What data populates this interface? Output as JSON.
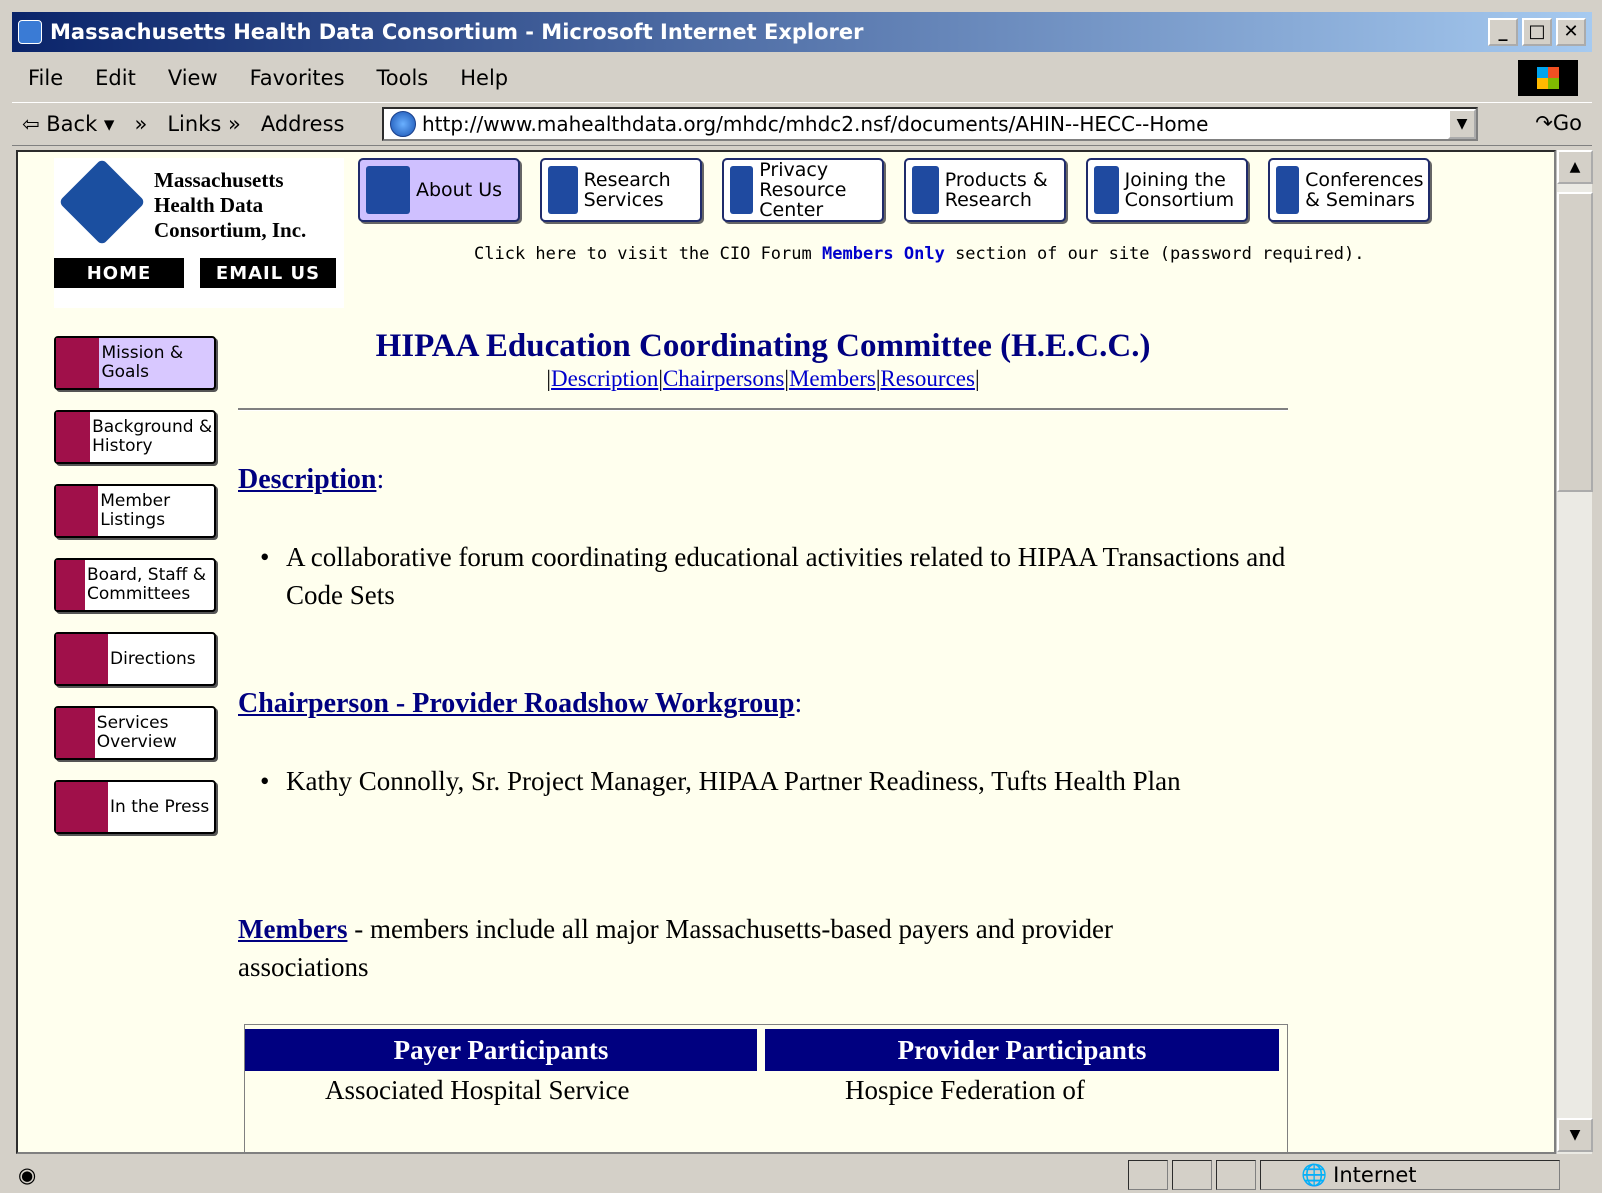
{
  "window": {
    "title": "Massachusetts Health Data Consortium - Microsoft Internet Explorer",
    "min": "_",
    "max": "□",
    "close": "✕"
  },
  "menu": [
    "File",
    "Edit",
    "View",
    "Favorites",
    "Tools",
    "Help"
  ],
  "toolbar": {
    "back": "⇦ Back ▾",
    "chev": "»",
    "links": "Links »",
    "address_label": "Address",
    "url": "http://www.mahealthdata.org/mhdc/mhdc2.nsf/documents/AHIN--HECC--Home",
    "go": "↷Go"
  },
  "logo": {
    "line1": "Massachusetts",
    "line2": "Health Data",
    "line3": "Consortium, Inc.",
    "home": "HOME",
    "email": "EMAIL US"
  },
  "nav": [
    "About Us",
    "Research Services",
    "Privacy Resource Center",
    "Products & Research",
    "Joining the Consortium",
    "Conferences & Seminars"
  ],
  "cio": {
    "before": "Click here to visit the CIO Forum ",
    "link": "Members Only",
    "after": " section of our site (password required)."
  },
  "sidebar": [
    "Mission & Goals",
    "Background & History",
    "Member Listings",
    "Board, Staff & Committees",
    "Directions",
    "Services Overview",
    "In the Press"
  ],
  "main": {
    "title": "HIPAA Education Coordinating Committee (H.E.C.C.)",
    "toc": [
      "Description",
      "Chairpersons",
      "Members",
      "Resources"
    ],
    "desc_heading": "Description",
    "desc_text": "A collaborative forum coordinating educational activities related to HIPAA Transactions and Code Sets",
    "chair_heading": "Chairperson - Provider Roadshow Workgroup",
    "chair_text": "Kathy Connolly, Sr. Project Manager, HIPAA Partner Readiness, Tufts Health Plan",
    "members_link": "Members",
    "members_text": " - members include all major Massachusetts-based payers and provider associations",
    "table": {
      "col1": "Payer Participants",
      "col2": "Provider Participants",
      "row1a": "Associated Hospital Service",
      "row1b": "Hospice Federation of"
    }
  },
  "status": {
    "zone": "Internet"
  }
}
